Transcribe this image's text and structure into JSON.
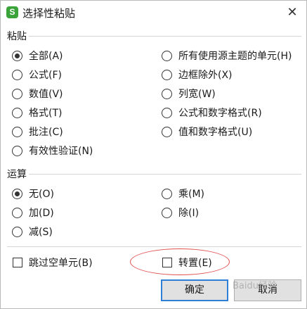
{
  "window": {
    "title": "选择性粘贴",
    "app_icon_letter": "S",
    "close_glyph": "✕"
  },
  "paste": {
    "label": "粘贴",
    "options": [
      {
        "label": "全部(A)",
        "checked": true
      },
      {
        "label": "所有使用源主题的单元(H)",
        "checked": false
      },
      {
        "label": "公式(F)",
        "checked": false
      },
      {
        "label": "边框除外(X)",
        "checked": false
      },
      {
        "label": "数值(V)",
        "checked": false
      },
      {
        "label": "列宽(W)",
        "checked": false
      },
      {
        "label": "格式(T)",
        "checked": false
      },
      {
        "label": "公式和数字格式(R)",
        "checked": false
      },
      {
        "label": "批注(C)",
        "checked": false
      },
      {
        "label": "值和数字格式(U)",
        "checked": false
      },
      {
        "label": "有效性验证(N)",
        "checked": false
      }
    ]
  },
  "operation": {
    "label": "运算",
    "options": [
      {
        "label": "无(O)",
        "checked": true
      },
      {
        "label": "乘(M)",
        "checked": false
      },
      {
        "label": "加(D)",
        "checked": false
      },
      {
        "label": "除(I)",
        "checked": false
      },
      {
        "label": "减(S)",
        "checked": false
      }
    ]
  },
  "checkboxes": {
    "skip_blanks": {
      "label": "跳过空单元(B)",
      "checked": false
    },
    "transpose": {
      "label": "转置(E)",
      "checked": false
    }
  },
  "buttons": {
    "ok": "确定",
    "cancel": "取消"
  },
  "watermark": "Baidu经验",
  "colors": {
    "accent": "#2f7ed8",
    "annotation": "#e05050",
    "app_icon": "#3aa33a"
  }
}
